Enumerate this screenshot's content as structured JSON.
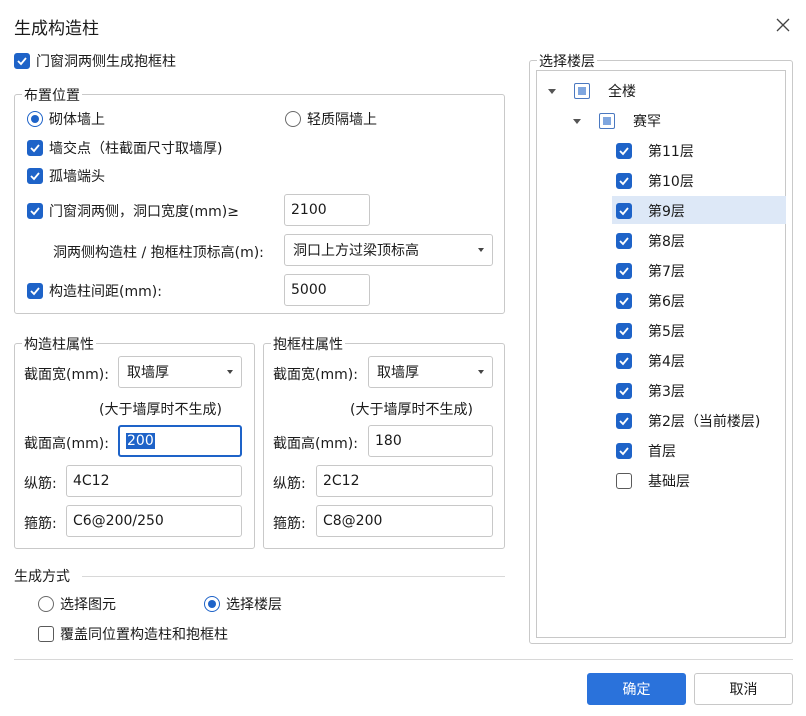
{
  "dialog": {
    "title": "生成构造柱"
  },
  "top_checkbox": {
    "label": "门窗洞两侧生成抱框柱",
    "checked": true
  },
  "placement": {
    "legend": "布置位置",
    "radio_masonry": "砌体墙上",
    "radio_light": "轻质隔墙上",
    "wall_intersection": "墙交点（柱截面尺寸取墙厚)",
    "isolated_wall_end": "孤墙端头",
    "door_window_sides": "门窗洞两侧，洞口宽度(mm)≥",
    "door_window_width": "2100",
    "top_elev_label": "洞两侧构造柱 / 抱框柱顶标高(m):",
    "top_elev_value": "洞口上方过梁顶标高",
    "spacing_label": "构造柱间距(mm):",
    "spacing_value": "5000"
  },
  "col_props": {
    "legend": "构造柱属性",
    "width_label": "截面宽(mm):",
    "width_value": "取墙厚",
    "note": "(大于墙厚时不生成)",
    "height_label": "截面高(mm):",
    "height_value": "200",
    "long_bar_label": "纵筋:",
    "long_bar_value": "4C12",
    "stirrup_label": "箍筋:",
    "stirrup_value": "C6@200/250"
  },
  "frame_props": {
    "legend": "抱框柱属性",
    "width_label": "截面宽(mm):",
    "width_value": "取墙厚",
    "note": "(大于墙厚时不生成)",
    "height_label": "截面高(mm):",
    "height_value": "180",
    "long_bar_label": "纵筋:",
    "long_bar_value": "2C12",
    "stirrup_label": "箍筋:",
    "stirrup_value": "C8@200"
  },
  "gen_mode": {
    "legend": "生成方式",
    "radio_elements": "选择图元",
    "radio_floors": "选择楼层",
    "overwrite": "覆盖同位置构造柱和抱框柱"
  },
  "floors": {
    "legend": "选择楼层",
    "root": "全楼",
    "building": "赛罕",
    "items": [
      {
        "label": "第11层",
        "checked": true
      },
      {
        "label": "第10层",
        "checked": true
      },
      {
        "label": "第9层",
        "checked": true
      },
      {
        "label": "第8层",
        "checked": true
      },
      {
        "label": "第7层",
        "checked": true
      },
      {
        "label": "第6层",
        "checked": true
      },
      {
        "label": "第5层",
        "checked": true
      },
      {
        "label": "第4层",
        "checked": true
      },
      {
        "label": "第3层",
        "checked": true
      },
      {
        "label": "第2层（当前楼层)",
        "checked": true
      },
      {
        "label": "首层",
        "checked": true
      },
      {
        "label": "基础层",
        "checked": false
      }
    ]
  },
  "buttons": {
    "ok": "确定",
    "cancel": "取消"
  },
  "colors": {
    "accent": "#1e63c8",
    "primary_button": "#2a72db",
    "selected_row": "#dde8f7"
  }
}
